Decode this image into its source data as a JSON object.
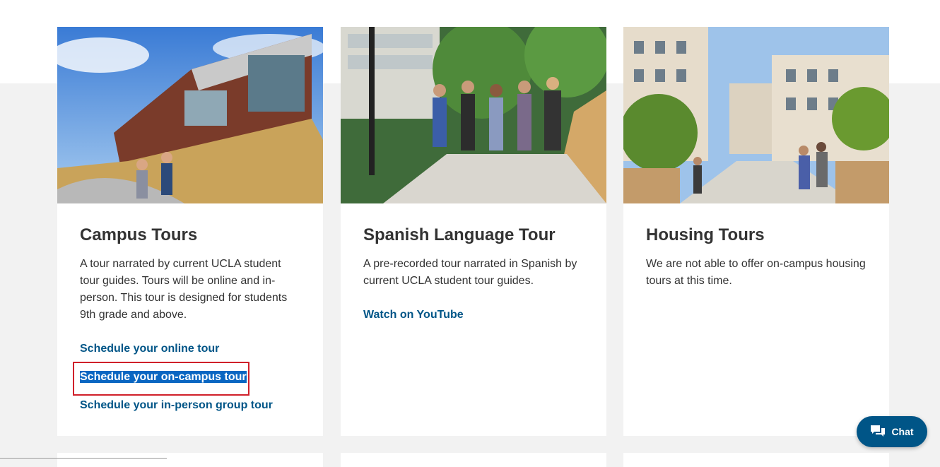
{
  "cards": [
    {
      "title": "Campus Tours",
      "description": "A tour narrated by current UCLA student tour guides. Tours will be online and in-person. This tour is designed for students 9th grade and above.",
      "links": [
        "Schedule your online tour",
        "Schedule your on-campus tour",
        "Schedule your in-person group tour"
      ],
      "selected_link_index": 1
    },
    {
      "title": "Spanish Language Tour",
      "description": "A pre-recorded tour narrated in Spanish by current UCLA student tour guides.",
      "links": [
        "Watch on YouTube"
      ]
    },
    {
      "title": "Housing Tours",
      "description": "We are not able to offer on-campus housing tours at this time.",
      "links": []
    }
  ],
  "chat": {
    "label": "Chat",
    "icon": "chat-bubbles-icon"
  },
  "colors": {
    "link": "#005587",
    "highlight_border": "#d0202a",
    "selection": "#0a66c2"
  }
}
